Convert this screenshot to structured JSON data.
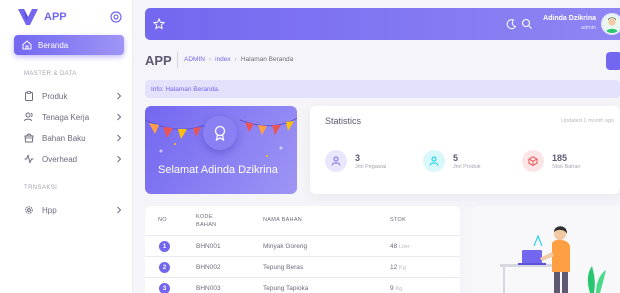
{
  "app": {
    "name": "APP"
  },
  "sidebar": {
    "active_item": {
      "label": "Beranda",
      "icon": "home-icon"
    },
    "sections": [
      {
        "title": "MASTER & DATA"
      },
      {
        "title": "TRNSAKSI"
      }
    ],
    "master_items": [
      {
        "label": "Produk",
        "icon": "clipboard-icon"
      },
      {
        "label": "Tenaga Kerja",
        "icon": "users-icon"
      },
      {
        "label": "Bahan Baku",
        "icon": "shopping-bag-icon"
      },
      {
        "label": "Overhead",
        "icon": "activity-icon"
      }
    ],
    "transaksi_items": [
      {
        "label": "Hpp",
        "icon": "gear-icon"
      }
    ]
  },
  "navbar": {
    "user_name": "Adinda Dzikrina",
    "user_role": "admin"
  },
  "breadcrumb": {
    "page_title": "APP",
    "items": [
      "ADMIN",
      "index",
      "Halaman Beranda"
    ]
  },
  "alert": {
    "text": "Info: Halaman Beranda."
  },
  "welcome": {
    "text": "Selamat Adinda Dzikrina"
  },
  "statistics": {
    "title": "Statistics",
    "updated": "Updated 1 month ago",
    "items": [
      {
        "value": "3",
        "label": "Jml Pegawai",
        "icon": "user-icon",
        "color": "#7367f0",
        "bg": "#e9e7fd"
      },
      {
        "value": "5",
        "label": "Jml Produk",
        "icon": "user-icon",
        "color": "#00cfe8",
        "bg": "#d9f8fc"
      },
      {
        "value": "185",
        "label": "Stok Bahan",
        "icon": "box-icon",
        "color": "#ea5455",
        "bg": "#fce5e6"
      }
    ]
  },
  "table": {
    "headers": {
      "no": "NO",
      "kode": "KODE BAHAN",
      "nama": "NAMA BAHAN",
      "stok": "STOK"
    },
    "rows": [
      {
        "no": "1",
        "kode": "BHN001",
        "nama": "Minyak Goreng",
        "stok": "48",
        "unit": "Liter"
      },
      {
        "no": "2",
        "kode": "BHN002",
        "nama": "Tepung Beras",
        "stok": "12",
        "unit": "Kg"
      },
      {
        "no": "3",
        "kode": "BHN003",
        "nama": "Tepung Tapioka",
        "stok": "9",
        "unit": "Kg"
      }
    ]
  },
  "colors": {
    "primary": "#7367f0",
    "info": "#00cfe8",
    "danger": "#ea5455"
  }
}
